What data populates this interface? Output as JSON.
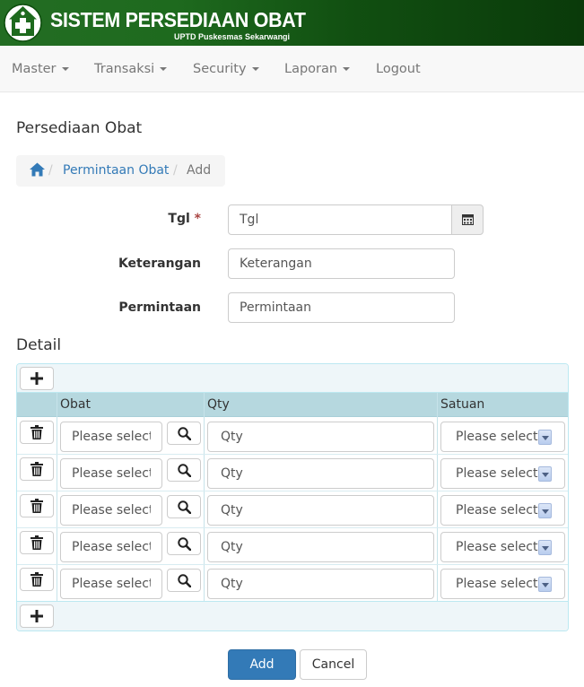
{
  "header": {
    "title": "SISTEM PERSEDIAAN OBAT",
    "subtitle": "UPTD Puskesmas Sekarwangi",
    "bg_color": "#1e6a1e"
  },
  "nav": {
    "items": [
      {
        "label": "Master",
        "dropdown": true
      },
      {
        "label": "Transaksi",
        "dropdown": true
      },
      {
        "label": "Security",
        "dropdown": true
      },
      {
        "label": "Laporan",
        "dropdown": true
      },
      {
        "label": "Logout",
        "dropdown": false
      }
    ]
  },
  "page": {
    "title": "Persediaan Obat"
  },
  "breadcrumb": {
    "home_icon": "home-icon",
    "link": "Permintaan Obat",
    "active": "Add"
  },
  "form": {
    "tgl": {
      "label": "Tgl",
      "required_mark": "*",
      "placeholder": "Tgl",
      "icon": "calendar-icon"
    },
    "keterangan": {
      "label": "Keterangan",
      "placeholder": "Keterangan"
    },
    "permintaan": {
      "label": "Permintaan",
      "placeholder": "Permintaan"
    }
  },
  "detail": {
    "title": "Detail",
    "columns": [
      "Obat",
      "Qty",
      "Satuan"
    ],
    "rows": [
      {
        "obat_placeholder": "Please select",
        "qty_placeholder": "Qty",
        "satuan": "Please select"
      },
      {
        "obat_placeholder": "Please select",
        "qty_placeholder": "Qty",
        "satuan": "Please select"
      },
      {
        "obat_placeholder": "Please select",
        "qty_placeholder": "Qty",
        "satuan": "Please select"
      },
      {
        "obat_placeholder": "Please select",
        "qty_placeholder": "Qty",
        "satuan": "Please select"
      },
      {
        "obat_placeholder": "Please select",
        "qty_placeholder": "Qty",
        "satuan": "Please select"
      }
    ]
  },
  "actions": {
    "add_label": "Add",
    "cancel_label": "Cancel"
  },
  "colors": {
    "primary": "#337ab7",
    "link": "#337ab7",
    "required": "#a94442",
    "table_header": "#b6d8df",
    "panel_border": "#bce8f1"
  }
}
